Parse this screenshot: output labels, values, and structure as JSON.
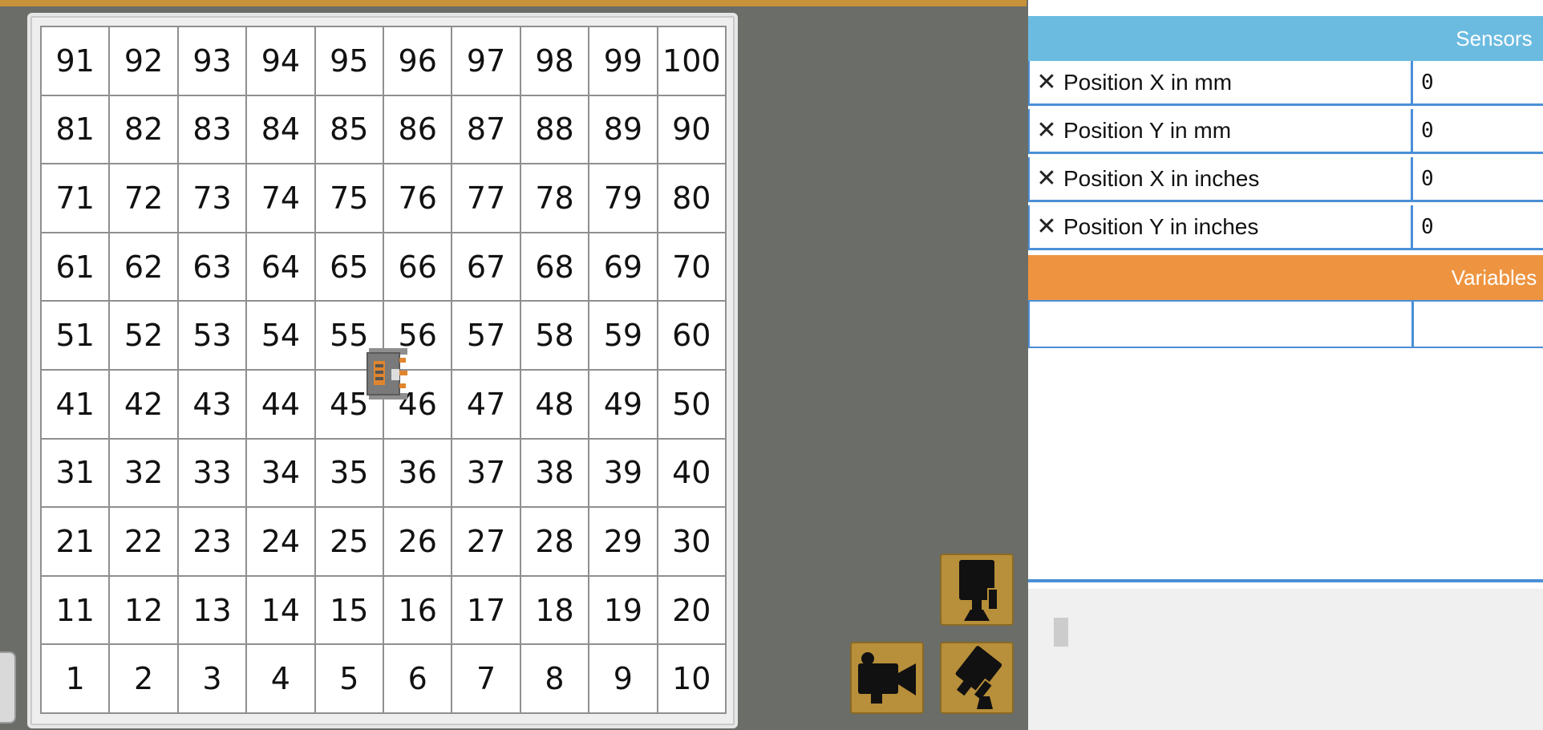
{
  "board": {
    "rows": [
      [
        "91",
        "92",
        "93",
        "94",
        "95",
        "96",
        "97",
        "98",
        "99",
        "100"
      ],
      [
        "81",
        "82",
        "83",
        "84",
        "85",
        "86",
        "87",
        "88",
        "89",
        "90"
      ],
      [
        "71",
        "72",
        "73",
        "74",
        "75",
        "76",
        "77",
        "78",
        "79",
        "80"
      ],
      [
        "61",
        "62",
        "63",
        "64",
        "65",
        "66",
        "67",
        "68",
        "69",
        "70"
      ],
      [
        "51",
        "52",
        "53",
        "54",
        "55",
        "56",
        "57",
        "58",
        "59",
        "60"
      ],
      [
        "41",
        "42",
        "43",
        "44",
        "45",
        "46",
        "47",
        "48",
        "49",
        "50"
      ],
      [
        "31",
        "32",
        "33",
        "34",
        "35",
        "36",
        "37",
        "38",
        "39",
        "40"
      ],
      [
        "21",
        "22",
        "23",
        "24",
        "25",
        "26",
        "27",
        "28",
        "29",
        "30"
      ],
      [
        "11",
        "12",
        "13",
        "14",
        "15",
        "16",
        "17",
        "18",
        "19",
        "20"
      ],
      [
        "1",
        "2",
        "3",
        "4",
        "5",
        "6",
        "7",
        "8",
        "9",
        "10"
      ]
    ]
  },
  "camera_buttons": [
    {
      "name": "camera-top-view-button",
      "icon": "robot-top-view-icon"
    },
    {
      "name": "camera-follow-button",
      "icon": "video-camera-icon"
    },
    {
      "name": "camera-angle-button",
      "icon": "tilted-camera-icon"
    }
  ],
  "sensors": {
    "header": "Sensors",
    "rows": [
      {
        "label": "Position X in mm",
        "value": "0",
        "remove_icon": "close-icon"
      },
      {
        "label": "Position Y in mm",
        "value": "0",
        "remove_icon": "close-icon"
      },
      {
        "label": "Position X in inches",
        "value": "0",
        "remove_icon": "close-icon"
      },
      {
        "label": "Position Y in inches",
        "value": "0",
        "remove_icon": "close-icon"
      }
    ]
  },
  "variables": {
    "header": "Variables"
  },
  "colors": {
    "sensors_header": "#6bbbe0",
    "variables_header": "#ee9440",
    "table_border": "#4a8fd6",
    "button_gold": "#b88f3a",
    "background": "#6a6d68"
  }
}
